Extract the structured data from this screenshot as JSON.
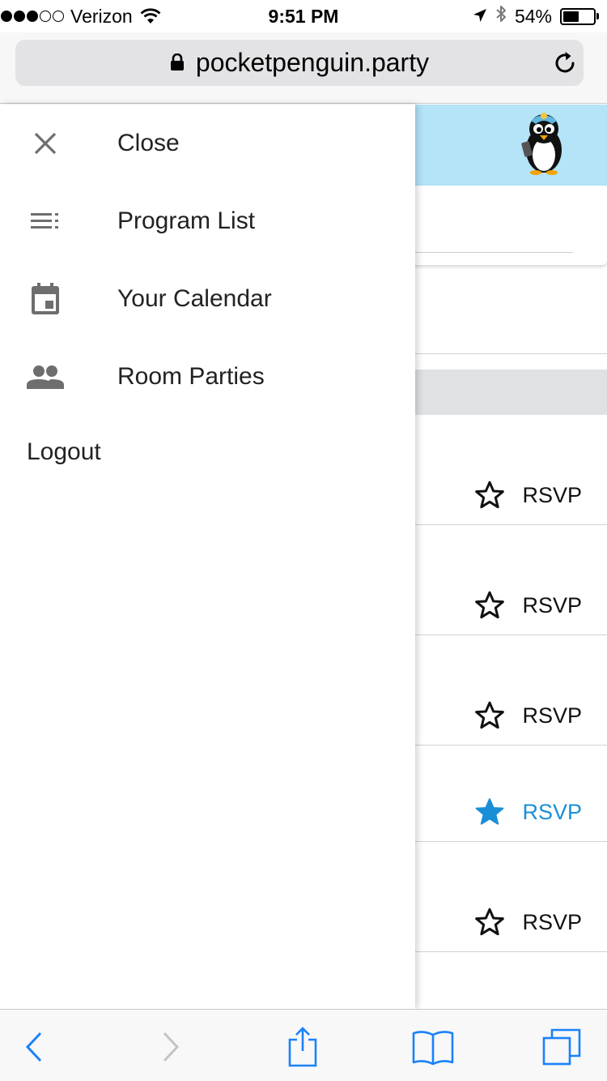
{
  "status_bar": {
    "carrier": "Verizon",
    "time": "9:51 PM",
    "battery_percent": "54%",
    "battery_level": 0.54,
    "signal_bars_filled": 3,
    "signal_bars_total": 5
  },
  "url_bar": {
    "url": "pocketpenguin.party"
  },
  "drawer": {
    "items": [
      {
        "label": "Close",
        "icon": "close-icon"
      },
      {
        "label": "Program List",
        "icon": "list-icon"
      },
      {
        "label": "Your Calendar",
        "icon": "calendar-icon"
      },
      {
        "label": "Room Parties",
        "icon": "people-icon"
      }
    ],
    "logout_label": "Logout"
  },
  "events": [
    {
      "rsvp_label": "RSVP",
      "starred": false
    },
    {
      "rsvp_label": "RSVP",
      "starred": false
    },
    {
      "rsvp_label": "RSVP",
      "starred": false
    },
    {
      "rsvp_label": "RSVP",
      "starred": true
    },
    {
      "rsvp_label": "RSVP",
      "starred": false
    }
  ],
  "colors": {
    "header_bg": "#b5e3f7",
    "accent": "#1a8fd6",
    "date_band": "#dfe1e4",
    "ios_blue": "#1a82fb"
  }
}
